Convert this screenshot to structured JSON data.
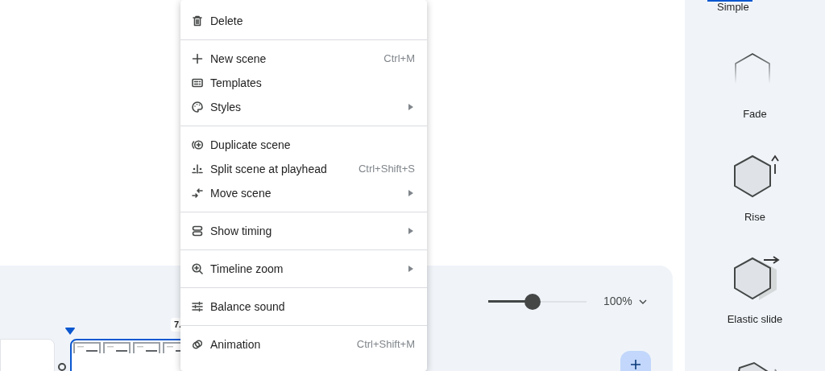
{
  "menu": {
    "sections": [
      {
        "items": [
          {
            "label": "Delete",
            "submenu": false
          }
        ]
      },
      {
        "items": [
          {
            "label": "New scene",
            "shortcut": "Ctrl+M",
            "submenu": false
          },
          {
            "label": "Templates",
            "submenu": false
          },
          {
            "label": "Styles",
            "submenu": true
          }
        ]
      },
      {
        "items": [
          {
            "label": "Duplicate scene",
            "submenu": false
          },
          {
            "label": "Split scene at playhead",
            "shortcut": "Ctrl+Shift+S",
            "submenu": false
          },
          {
            "label": "Move scene",
            "submenu": true
          }
        ]
      },
      {
        "items": [
          {
            "label": "Show timing",
            "submenu": true
          }
        ]
      },
      {
        "items": [
          {
            "label": "Timeline zoom",
            "submenu": true
          }
        ]
      },
      {
        "items": [
          {
            "label": "Balance sound",
            "submenu": false
          }
        ]
      },
      {
        "items": [
          {
            "label": "Animation",
            "shortcut": "Ctrl+Shift+M",
            "submenu": false
          }
        ]
      }
    ]
  },
  "timeline": {
    "time_label": "7.",
    "zoom": {
      "level": 0.45,
      "value": "100%"
    }
  },
  "animation_panel": {
    "tab": {
      "label": "Simple",
      "selected": true
    },
    "items": [
      {
        "label": "Fade",
        "kind": "fade"
      },
      {
        "label": "Rise",
        "kind": "rise"
      },
      {
        "label": "Elastic slide",
        "kind": "slide"
      },
      {
        "kind": "wobble"
      }
    ]
  }
}
